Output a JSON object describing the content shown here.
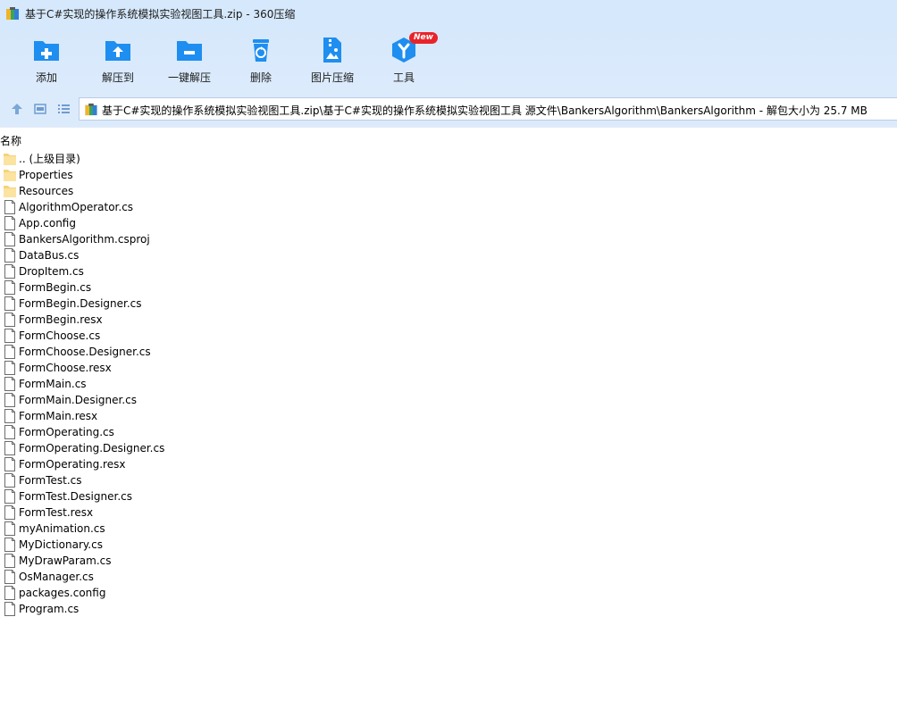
{
  "window": {
    "title": "基于C#实现的操作系统模拟实验视图工具.zip - 360压缩",
    "app_icon": "archive-app-icon"
  },
  "toolbar": {
    "items": [
      {
        "label": "添加",
        "icon": "add-folder-icon"
      },
      {
        "label": "解压到",
        "icon": "extract-to-icon"
      },
      {
        "label": "一键解压",
        "icon": "quick-extract-icon"
      },
      {
        "label": "删除",
        "icon": "recycle-bin-icon"
      },
      {
        "label": "图片压缩",
        "icon": "image-compress-icon"
      },
      {
        "label": "工具",
        "icon": "tools-cube-icon",
        "badge": "New"
      }
    ],
    "accent": "#1e8ef0",
    "badge_color": "#e8242a"
  },
  "addressbar": {
    "path": "基于C#实现的操作系统模拟实验视图工具.zip\\基于C#实现的操作系统模拟实验视图工具 源文件\\BankersAlgorithm\\BankersAlgorithm - 解包大小为 25.7 MB"
  },
  "list": {
    "column_header": "名称",
    "items": [
      {
        "name": ".. (上级目录)",
        "type": "folder"
      },
      {
        "name": "Properties",
        "type": "folder"
      },
      {
        "name": "Resources",
        "type": "folder"
      },
      {
        "name": "AlgorithmOperator.cs",
        "type": "file"
      },
      {
        "name": "App.config",
        "type": "file"
      },
      {
        "name": "BankersAlgorithm.csproj",
        "type": "file"
      },
      {
        "name": "DataBus.cs",
        "type": "file"
      },
      {
        "name": "DropItem.cs",
        "type": "file"
      },
      {
        "name": "FormBegin.cs",
        "type": "file"
      },
      {
        "name": "FormBegin.Designer.cs",
        "type": "file"
      },
      {
        "name": "FormBegin.resx",
        "type": "file"
      },
      {
        "name": "FormChoose.cs",
        "type": "file"
      },
      {
        "name": "FormChoose.Designer.cs",
        "type": "file"
      },
      {
        "name": "FormChoose.resx",
        "type": "file"
      },
      {
        "name": "FormMain.cs",
        "type": "file"
      },
      {
        "name": "FormMain.Designer.cs",
        "type": "file"
      },
      {
        "name": "FormMain.resx",
        "type": "file"
      },
      {
        "name": "FormOperating.cs",
        "type": "file"
      },
      {
        "name": "FormOperating.Designer.cs",
        "type": "file"
      },
      {
        "name": "FormOperating.resx",
        "type": "file"
      },
      {
        "name": "FormTest.cs",
        "type": "file"
      },
      {
        "name": "FormTest.Designer.cs",
        "type": "file"
      },
      {
        "name": "FormTest.resx",
        "type": "file"
      },
      {
        "name": "myAnimation.cs",
        "type": "file"
      },
      {
        "name": "MyDictionary.cs",
        "type": "file"
      },
      {
        "name": "MyDrawParam.cs",
        "type": "file"
      },
      {
        "name": "OsManager.cs",
        "type": "file"
      },
      {
        "name": "packages.config",
        "type": "file"
      },
      {
        "name": "Program.cs",
        "type": "file"
      }
    ]
  }
}
